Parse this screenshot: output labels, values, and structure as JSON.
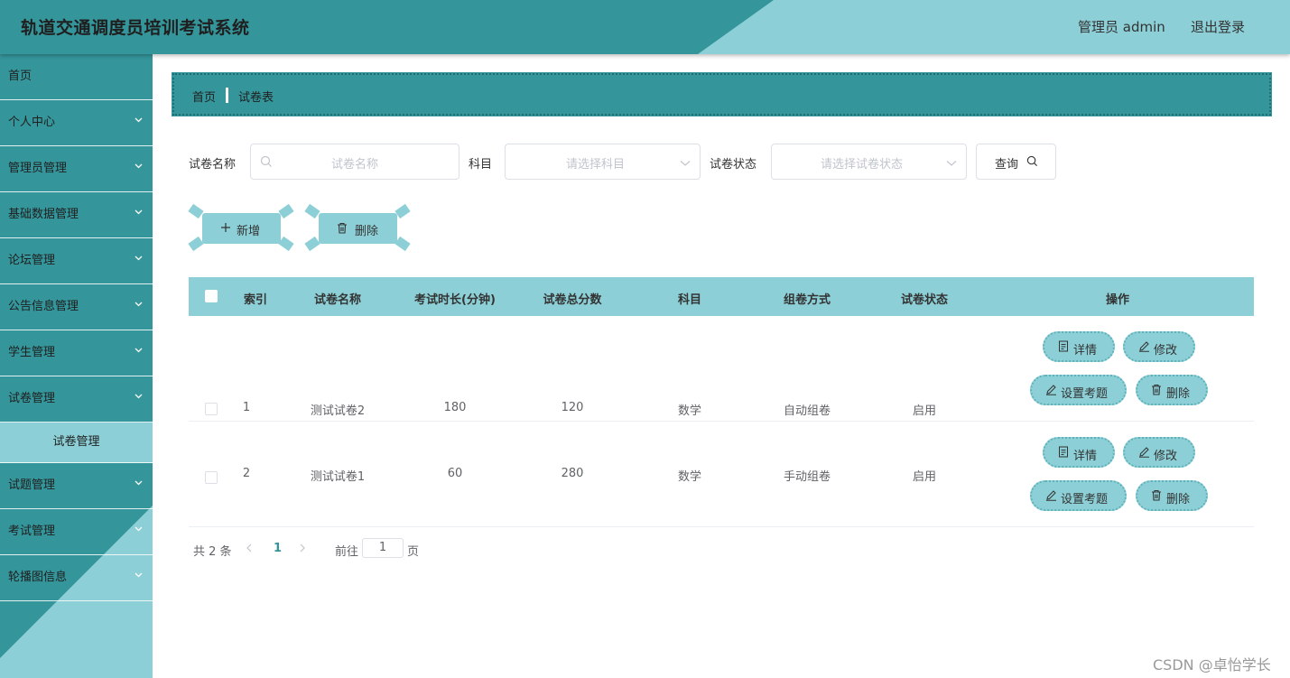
{
  "header": {
    "title": "轨道交通调度员培训考试系统",
    "user": "管理员 admin",
    "logout": "退出登录"
  },
  "sidebar": {
    "items": [
      {
        "label": "首页",
        "chevron": false
      },
      {
        "label": "个人中心",
        "chevron": true
      },
      {
        "label": "管理员管理",
        "chevron": true
      },
      {
        "label": "基础数据管理",
        "chevron": true
      },
      {
        "label": "论坛管理",
        "chevron": true
      },
      {
        "label": "公告信息管理",
        "chevron": true
      },
      {
        "label": "学生管理",
        "chevron": true
      },
      {
        "label": "试卷管理",
        "chevron": true
      }
    ],
    "submenu": "试卷管理",
    "items_after": [
      {
        "label": "试题管理",
        "chevron": true
      },
      {
        "label": "考试管理",
        "chevron": true
      },
      {
        "label": "轮播图信息",
        "chevron": true
      }
    ]
  },
  "breadcrumb": {
    "home": "首页",
    "current": "试卷表"
  },
  "search": {
    "name_label": "试卷名称",
    "name_placeholder": "试卷名称",
    "subject_label": "科目",
    "subject_placeholder": "请选择科目",
    "status_label": "试卷状态",
    "status_placeholder": "请选择试卷状态",
    "query_button": "查询"
  },
  "actions": {
    "add": "新增",
    "delete": "删除"
  },
  "table": {
    "headers": [
      "索引",
      "试卷名称",
      "考试时长(分钟)",
      "试卷总分数",
      "科目",
      "组卷方式",
      "试卷状态",
      "操作"
    ],
    "rows": [
      {
        "index": "1",
        "name": "测试试卷2",
        "duration": "180",
        "total": "120",
        "subject": "数学",
        "method": "自动组卷",
        "status": "启用"
      },
      {
        "index": "2",
        "name": "测试试卷1",
        "duration": "60",
        "total": "280",
        "subject": "数学",
        "method": "手动组卷",
        "status": "启用"
      }
    ],
    "row_buttons": {
      "detail": "详情",
      "edit": "修改",
      "set_questions": "设置考题",
      "delete": "删除"
    }
  },
  "pagination": {
    "total": "共 2 条",
    "current": "1",
    "goto": "前往",
    "page_value": "1",
    "unit": "页"
  },
  "watermark": "CSDN @卓怡学长",
  "colors": {
    "primary_dark": "#34959a",
    "primary_light": "#8ccfd6",
    "active_page": "#34959a"
  }
}
